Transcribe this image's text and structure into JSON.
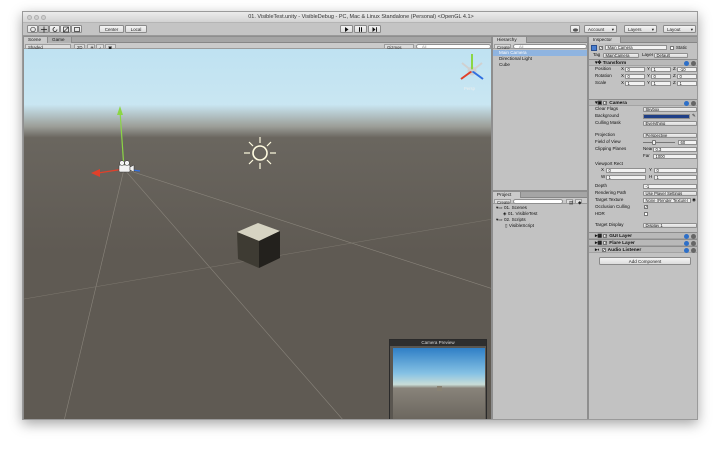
{
  "window": {
    "title": "01. VisibleTest.unity - VisibleDebug - PC, Mac & Linux Standalone (Personal) <OpenGL 4.1>"
  },
  "toolbar": {
    "tools": [
      "hand-tool",
      "move-tool",
      "rotate-tool",
      "scale-tool",
      "rect-tool"
    ],
    "center_label": "Center",
    "local_label": "Local",
    "account_label": "Account",
    "layers_label": "Layers",
    "layout_label": "Layout"
  },
  "scene": {
    "tabs": [
      "Scene",
      "Game"
    ],
    "shading_mode": "Shaded",
    "mode_2d": "2D",
    "gizmos_label": "Gizmos",
    "search_placeholder": "All",
    "persp_label": "Persp",
    "camera_preview_title": "Camera Preview"
  },
  "hierarchy": {
    "tab": "Hierarchy",
    "create_label": "Create",
    "search_placeholder": "All",
    "items": [
      "Main Camera",
      "Directional Light",
      "Cube"
    ],
    "selected_index": 0
  },
  "project": {
    "tab": "Project",
    "create_label": "Create",
    "items": [
      {
        "label": "01. Scenes",
        "indent": 0
      },
      {
        "label": "01. VisibleTest",
        "indent": 1
      },
      {
        "label": "02. Scripts",
        "indent": 0
      },
      {
        "label": "VisibleScript",
        "indent": 1
      }
    ]
  },
  "inspector": {
    "tab": "Inspector",
    "object_name": "Main Camera",
    "static_label": "Static",
    "tag_label": "Tag",
    "tag_value": "MainCamera",
    "layer_label": "Layer",
    "layer_value": "Default",
    "transform": {
      "title": "Transform",
      "rows": [
        {
          "label": "Position",
          "x": "0",
          "y": "1",
          "z": "-10"
        },
        {
          "label": "Rotation",
          "x": "0",
          "y": "0",
          "z": "0"
        },
        {
          "label": "Scale",
          "x": "1",
          "y": "1",
          "z": "1"
        }
      ]
    },
    "camera": {
      "title": "Camera",
      "clear_flags_label": "Clear Flags",
      "clear_flags_value": "Skybox",
      "background_label": "Background",
      "culling_mask_label": "Culling Mask",
      "culling_mask_value": "Everything",
      "projection_label": "Projection",
      "projection_value": "Perspective",
      "fov_label": "Field of View",
      "fov_value": "60",
      "fov_fraction": 0.33,
      "clipping_label": "Clipping Planes",
      "near_label": "Near",
      "near_value": "0.3",
      "far_label": "Far",
      "far_value": "1000",
      "viewport_label": "Viewport Rect",
      "vp_x_label": "X",
      "vp_x": "0",
      "vp_y_label": "Y",
      "vp_y": "0",
      "vp_w_label": "W",
      "vp_w": "1",
      "vp_h_label": "H",
      "vp_h": "1",
      "depth_label": "Depth",
      "depth_value": "-1",
      "render_path_label": "Rendering Path",
      "render_path_value": "Use Player Settings",
      "target_texture_label": "Target Texture",
      "target_texture_value": "None (Render Texture)",
      "occlusion_label": "Occlusion Culling",
      "hdr_label": "HDR",
      "target_display_label": "Target Display",
      "target_display_value": "Display 1"
    },
    "components": [
      "GUI Layer",
      "Flare Layer",
      "Audio Listener"
    ],
    "add_component_label": "Add Component"
  },
  "colors": {
    "selection": "#8fb4e0",
    "camera_background": "#1f3f86",
    "axis_x": "#e0402a",
    "axis_y": "#8bd645",
    "axis_z": "#2f6fe0"
  }
}
